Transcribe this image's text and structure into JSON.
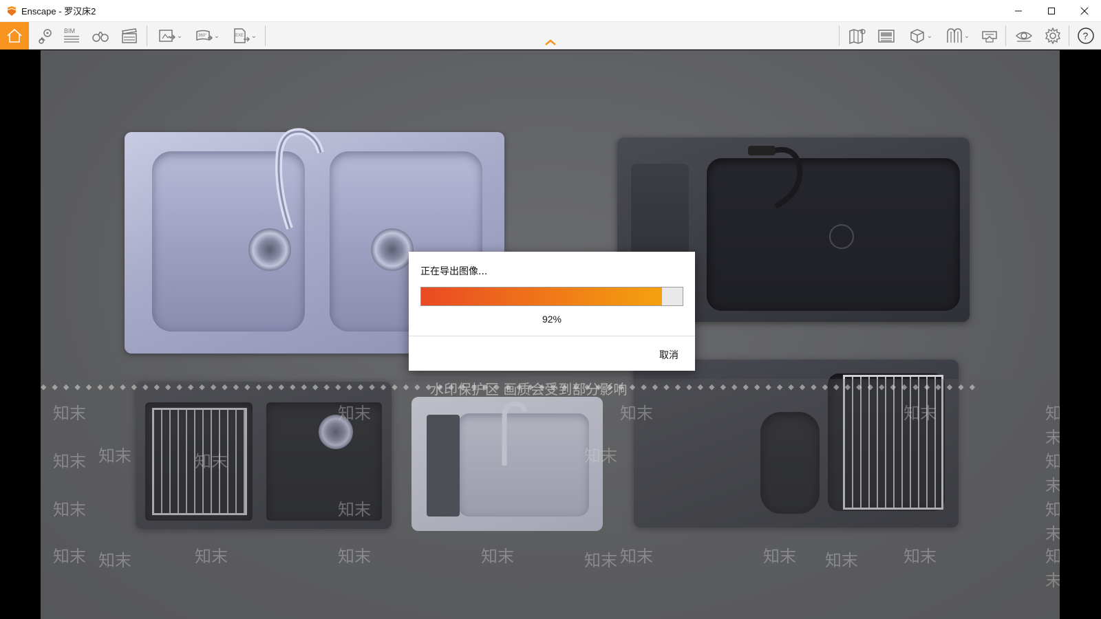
{
  "window": {
    "title": "Enscape - 罗汉床2",
    "controls": {
      "minimize": "minimize-icon",
      "maximize": "maximize-icon",
      "close": "close-icon"
    }
  },
  "toolbar": {
    "left_items": [
      {
        "icon": "home-icon",
        "active": true
      },
      {
        "icon": "location-pin-icon"
      },
      {
        "icon": "bim-icon",
        "label": "BIM"
      },
      {
        "icon": "binoculars-icon"
      },
      {
        "icon": "clapperboard-icon"
      },
      {
        "icon": "screenshot-export-icon",
        "dropdown": true
      },
      {
        "icon": "panorama-360-icon",
        "label": "360°",
        "dropdown": true
      },
      {
        "icon": "exe-export-icon",
        "label": "EXE",
        "dropdown": true
      }
    ],
    "right_items": [
      {
        "icon": "map-icon"
      },
      {
        "icon": "asset-library-icon"
      },
      {
        "icon": "cube-icon",
        "dropdown": true
      },
      {
        "icon": "material-icon",
        "dropdown": true
      },
      {
        "icon": "vr-headset-icon"
      },
      {
        "icon": "eye-icon"
      },
      {
        "icon": "settings-gear-icon"
      },
      {
        "icon": "help-icon"
      }
    ],
    "accent_color": "#f7931e"
  },
  "viewport": {
    "watermark_banner": "水印保护区  画质会受到部分影响",
    "watermark_text": "知末"
  },
  "dialog": {
    "title": "正在导出图像...",
    "progress": 0.92,
    "percent_label": "92%",
    "cancel_label": "取消",
    "progress_colors": [
      "#ea4a24",
      "#f4a10f"
    ]
  }
}
